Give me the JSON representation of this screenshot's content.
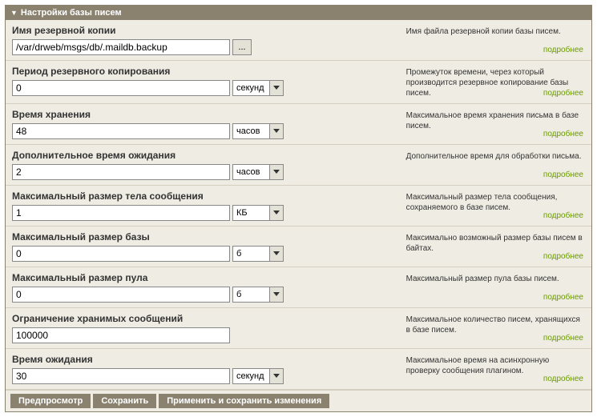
{
  "header": {
    "title": "Настройки базы писем"
  },
  "rows": [
    {
      "label": "Имя резервной копии",
      "value": "/var/drweb/msgs/db/.maildb.backup",
      "browse": "...",
      "unit": null,
      "desc": "Имя файла резервной копии базы писем.",
      "more": "подробнее"
    },
    {
      "label": "Период резервного копирования",
      "value": "0",
      "unit": "секунд",
      "desc": "Промежуток времени, через который производится резервное копирование базы писем.",
      "more": "подробнее"
    },
    {
      "label": "Время хранения",
      "value": "48",
      "unit": "часов",
      "desc": "Максимальное время хранения письма в базе писем.",
      "more": "подробнее"
    },
    {
      "label": "Дополнительное время ожидания",
      "value": "2",
      "unit": "часов",
      "desc": "Дополнительное время для обработки письма.",
      "more": "подробнее"
    },
    {
      "label": "Максимальный размер тела сообщения",
      "value": "1",
      "unit": "КБ",
      "desc": "Максимальный размер тела сообщения, сохраняемого в базе писем.",
      "more": "подробнее"
    },
    {
      "label": "Максимальный размер базы",
      "value": "0",
      "unit": "б",
      "desc": "Максимально возможный размер базы писем в байтах.",
      "more": "подробнее"
    },
    {
      "label": "Максимальный размер пула",
      "value": "0",
      "unit": "б",
      "desc": "Максимальный размер пула базы писем.",
      "more": "подробнее"
    },
    {
      "label": "Ограничение хранимых сообщений",
      "value": "100000",
      "unit": null,
      "desc": "Максимальное количество писем, хранящихся в базе писем.",
      "more": "подробнее"
    },
    {
      "label": "Время ожидания",
      "value": "30",
      "unit": "секунд",
      "desc": "Максимальное время на асинхронную проверку сообщения плагином.",
      "more": "подробнее"
    }
  ],
  "footer": {
    "preview": "Предпросмотр",
    "save": "Сохранить",
    "apply": "Применить и сохранить изменения"
  }
}
